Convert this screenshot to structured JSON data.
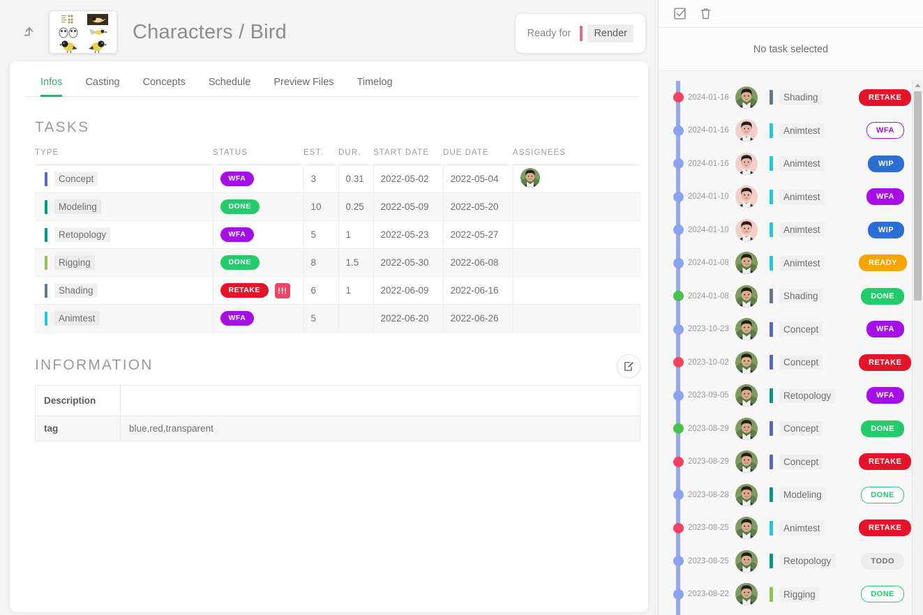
{
  "header": {
    "back_icon": "level-up-arrow-icon",
    "title": "Characters / Bird",
    "thumbnail_alt": "bird-concept-thumbnail",
    "ready_label": "Ready for",
    "ready_value": "Render",
    "ready_accent": "#ec5f8f"
  },
  "tabs": [
    {
      "label": "Infos",
      "active": true
    },
    {
      "label": "Casting",
      "active": false
    },
    {
      "label": "Concepts",
      "active": false
    },
    {
      "label": "Schedule",
      "active": false
    },
    {
      "label": "Preview Files",
      "active": false
    },
    {
      "label": "Timelog",
      "active": false
    }
  ],
  "tasks_section": {
    "title": "TASKS",
    "columns": [
      "TYPE",
      "STATUS",
      "EST.",
      "DUR.",
      "START DATE",
      "DUE DATE",
      "ASSIGNEES"
    ],
    "rows": [
      {
        "type": "Concept",
        "type_color": "#5566c4",
        "status": "WFA",
        "status_bg": "#a70fe8",
        "status_fg": "#ffffff",
        "outline": false,
        "priority": "",
        "est": "3",
        "dur": "0.31",
        "start": "2022-05-02",
        "due": "2022-05-04",
        "assignee": true
      },
      {
        "type": "Modeling",
        "type_color": "#009a84",
        "status": "DONE",
        "status_bg": "#22cc6a",
        "status_fg": "#ffffff",
        "outline": false,
        "priority": "",
        "est": "10",
        "dur": "0.25",
        "start": "2022-05-09",
        "due": "2022-05-20",
        "assignee": false
      },
      {
        "type": "Retopology",
        "type_color": "#009a84",
        "status": "WFA",
        "status_bg": "#a70fe8",
        "status_fg": "#ffffff",
        "outline": false,
        "priority": "",
        "est": "5",
        "dur": "1",
        "start": "2022-05-23",
        "due": "2022-05-27",
        "assignee": false
      },
      {
        "type": "Rigging",
        "type_color": "#8ec552",
        "status": "DONE",
        "status_bg": "#22cc6a",
        "status_fg": "#ffffff",
        "outline": false,
        "priority": "",
        "est": "8",
        "dur": "1.5",
        "start": "2022-05-30",
        "due": "2022-06-08",
        "assignee": false
      },
      {
        "type": "Shading",
        "type_color": "#62798a",
        "status": "RETAKE",
        "status_bg": "#e6142a",
        "status_fg": "#ffffff",
        "outline": false,
        "priority": "!!!",
        "priority_bg": "#f4436a",
        "est": "6",
        "dur": "1",
        "start": "2022-06-09",
        "due": "2022-06-16",
        "assignee": false
      },
      {
        "type": "Animtest",
        "type_color": "#22c7e0",
        "status": "WFA",
        "status_bg": "#a70fe8",
        "status_fg": "#ffffff",
        "outline": false,
        "priority": "",
        "est": "5",
        "dur": "",
        "start": "2022-06-20",
        "due": "2022-06-26",
        "assignee": false
      }
    ]
  },
  "information_section": {
    "title": "INFORMATION",
    "edit_icon": "edit-pencil-icon",
    "rows": [
      {
        "key": "Description",
        "value": ""
      },
      {
        "key": "tag",
        "value": "blue,red,transparent"
      }
    ]
  },
  "panel": {
    "toolbar": [
      {
        "icon": "checkbox-check-icon"
      },
      {
        "icon": "trash-icon"
      }
    ],
    "empty_text": "No task selected",
    "history": [
      {
        "date": "2024-01-16",
        "dot": "#f6425f",
        "avatar": "green",
        "type": "Shading",
        "type_color": "#62798a",
        "status": "RETAKE",
        "status_bg": "#e6142a",
        "status_fg": "#ffffff",
        "outline": false
      },
      {
        "date": "2024-01-16",
        "dot": "#8ba4ef",
        "avatar": "pink",
        "type": "Animtest",
        "type_color": "#22c7e0",
        "status": "WFA",
        "status_bg": "#ffffff",
        "status_fg": "#a70fe8",
        "outline": true
      },
      {
        "date": "2024-01-16",
        "dot": "#8ba4ef",
        "avatar": "pink",
        "type": "Animtest",
        "type_color": "#22c7e0",
        "status": "WIP",
        "status_bg": "#2b6fd4",
        "status_fg": "#ffffff",
        "outline": false
      },
      {
        "date": "2024-01-10",
        "dot": "#8ba4ef",
        "avatar": "pink",
        "type": "Animtest",
        "type_color": "#22c7e0",
        "status": "WFA",
        "status_bg": "#a70fe8",
        "status_fg": "#ffffff",
        "outline": false
      },
      {
        "date": "2024-01-10",
        "dot": "#8ba4ef",
        "avatar": "pink",
        "type": "Animtest",
        "type_color": "#22c7e0",
        "status": "WIP",
        "status_bg": "#2b6fd4",
        "status_fg": "#ffffff",
        "outline": false
      },
      {
        "date": "2024-01-08",
        "dot": "#8ba4ef",
        "avatar": "green",
        "type": "Animtest",
        "type_color": "#22c7e0",
        "status": "READY",
        "status_bg": "#f7a400",
        "status_fg": "#ffffff",
        "outline": false
      },
      {
        "date": "2024-01-08",
        "dot": "#4bc14b",
        "avatar": "green",
        "type": "Shading",
        "type_color": "#62798a",
        "status": "DONE",
        "status_bg": "#22cc6a",
        "status_fg": "#ffffff",
        "outline": false
      },
      {
        "date": "2023-10-23",
        "dot": "#8ba4ef",
        "avatar": "green",
        "type": "Concept",
        "type_color": "#5566c4",
        "status": "WFA",
        "status_bg": "#a70fe8",
        "status_fg": "#ffffff",
        "outline": false
      },
      {
        "date": "2023-10-02",
        "dot": "#f6425f",
        "avatar": "green",
        "type": "Concept",
        "type_color": "#5566c4",
        "status": "RETAKE",
        "status_bg": "#e6142a",
        "status_fg": "#ffffff",
        "outline": false
      },
      {
        "date": "2023-09-05",
        "dot": "#8ba4ef",
        "avatar": "green",
        "type": "Retopology",
        "type_color": "#009a84",
        "status": "WFA",
        "status_bg": "#a70fe8",
        "status_fg": "#ffffff",
        "outline": false
      },
      {
        "date": "2023-08-29",
        "dot": "#4bc14b",
        "avatar": "green",
        "type": "Concept",
        "type_color": "#5566c4",
        "status": "DONE",
        "status_bg": "#22cc6a",
        "status_fg": "#ffffff",
        "outline": false
      },
      {
        "date": "2023-08-29",
        "dot": "#f6425f",
        "avatar": "green",
        "type": "Concept",
        "type_color": "#5566c4",
        "status": "RETAKE",
        "status_bg": "#e6142a",
        "status_fg": "#ffffff",
        "outline": false
      },
      {
        "date": "2023-08-28",
        "dot": "#8ba4ef",
        "avatar": "green",
        "type": "Modeling",
        "type_color": "#009a84",
        "status": "DONE",
        "status_bg": "#ffffff",
        "status_fg": "#22cc6a",
        "outline": true
      },
      {
        "date": "2023-08-25",
        "dot": "#f6425f",
        "avatar": "green",
        "type": "Animtest",
        "type_color": "#22c7e0",
        "status": "RETAKE",
        "status_bg": "#e6142a",
        "status_fg": "#ffffff",
        "outline": false
      },
      {
        "date": "2023-08-25",
        "dot": "#8ba4ef",
        "avatar": "green",
        "type": "Retopology",
        "type_color": "#009a84",
        "status": "TODO",
        "status_bg": "#ececec",
        "status_fg": "#707070",
        "outline": false
      },
      {
        "date": "2023-08-22",
        "dot": "#8ba4ef",
        "avatar": "green",
        "type": "Rigging",
        "type_color": "#8ec552",
        "status": "DONE",
        "status_bg": "#ffffff",
        "status_fg": "#22cc6a",
        "outline": true
      }
    ]
  }
}
